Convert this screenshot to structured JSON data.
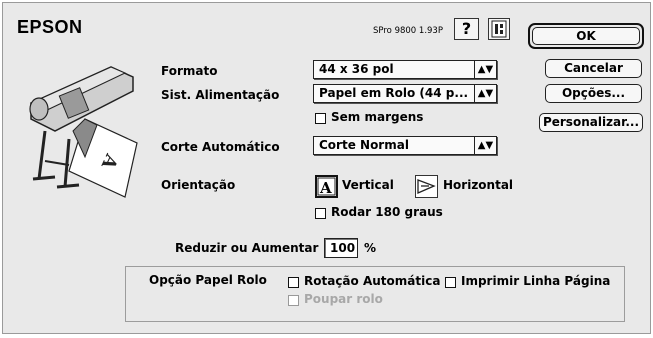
{
  "header": {
    "brand": "EPSON",
    "version": "SPro 9800 1.93P",
    "help_label": "?"
  },
  "buttons": {
    "ok": "OK",
    "cancel": "Cancelar",
    "options": "Opções...",
    "customize": "Personalizar..."
  },
  "form": {
    "format_label": "Formato",
    "format_value": "44 x 36 pol",
    "feed_label": "Sist. Alimentação",
    "feed_value": "Papel em Rolo (44 p...",
    "borderless_label": "Sem margens",
    "autocut_label": "Corte Automático",
    "autocut_value": "Corte Normal",
    "orientation_label": "Orientação",
    "portrait_label": "Vertical",
    "landscape_label": "Horizontal",
    "rotate_label": "Rodar 180 graus",
    "reduce_label": "Reduzir ou Aumentar",
    "reduce_value": "100",
    "percent": "%"
  },
  "roll_options": {
    "title": "Opção Papel Rolo",
    "auto_rotate": "Rotação Automática",
    "print_page_line": "Imprimir Linha Página",
    "save_roll": "Poupar rolo"
  }
}
